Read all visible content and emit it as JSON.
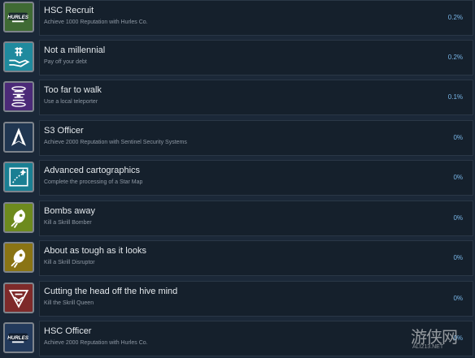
{
  "achievements": [
    {
      "title": "HSC Recruit",
      "description": "Achieve 1000 Reputation with Hurles Co.",
      "percent": "0.2%",
      "icon": "hurles-logo-icon",
      "icon_bg": "#3f6a34",
      "icon_accent": "#ffffff"
    },
    {
      "title": "Not a millennial",
      "description": "Pay off your debt",
      "percent": "0.2%",
      "icon": "hand-coin-icon",
      "icon_bg": "#1f8a9e",
      "icon_accent": "#ffffff"
    },
    {
      "title": "Too far to walk",
      "description": "Use a local teleporter",
      "percent": "0.1%",
      "icon": "teleporter-icon",
      "icon_bg": "#4b2a78",
      "icon_accent": "#ffffff"
    },
    {
      "title": "S3 Officer",
      "description": "Achieve 2000 Reputation with Sentinel Security Systems",
      "percent": "0%",
      "icon": "sentinel-arrow-icon",
      "icon_bg": "#203651",
      "icon_accent": "#ffffff"
    },
    {
      "title": "Advanced cartographics",
      "description": "Complete the processing of a Star Map",
      "percent": "0%",
      "icon": "star-map-icon",
      "icon_bg": "#1a7f93",
      "icon_accent": "#ffffff"
    },
    {
      "title": "Bombs away",
      "description": "Kill a Skrill Bomber",
      "percent": "0%",
      "icon": "skrill-bomber-icon",
      "icon_bg": "#6d8a1e",
      "icon_accent": "#ffffff"
    },
    {
      "title": "About as tough as it looks",
      "description": "Kill a Skrill Disruptor",
      "percent": "0%",
      "icon": "skrill-disruptor-icon",
      "icon_bg": "#8a7414",
      "icon_accent": "#ffffff"
    },
    {
      "title": "Cutting the head off the hive mind",
      "description": "Kill the Skrill Queen",
      "percent": "0%",
      "icon": "skrill-queen-icon",
      "icon_bg": "#7e2a2a",
      "icon_accent": "#ffffff"
    },
    {
      "title": "HSC Officer",
      "description": "Achieve 2000 Reputation with Hurles Co.",
      "percent": "0%",
      "icon": "hurles-logo-icon",
      "icon_bg": "#233a5c",
      "icon_accent": "#ffffff"
    }
  ],
  "watermark": {
    "text": "游侠网",
    "url": "ALI213.NET"
  }
}
